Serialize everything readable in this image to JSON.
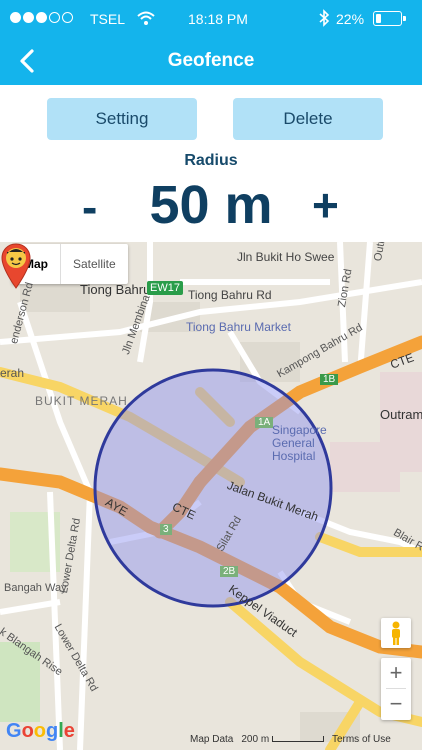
{
  "status_bar": {
    "carrier": "TSEL",
    "time": "18:18 PM",
    "battery_percent": "22%",
    "battery_level": 0.22
  },
  "nav": {
    "title": "Geofence"
  },
  "actions": {
    "setting_label": "Setting",
    "delete_label": "Delete"
  },
  "radius": {
    "label": "Radius",
    "minus_label": "-",
    "plus_label": "+",
    "value": "50 m"
  },
  "map": {
    "type_buttons": [
      "Map",
      "Satellite"
    ],
    "zoom_in_label": "+",
    "zoom_out_label": "−",
    "attribution": "Map Data",
    "scale_label": "200 m",
    "terms_label": "Terms of Use",
    "logo": "Google",
    "labels": {
      "jln_bukit_ho_swee": "Jln Bukit Ho Swee",
      "tiong_bahru": "Tiong Bahru",
      "ew17": "EW17",
      "tiong_bahru_rd": "Tiong Bahru Rd",
      "tiong_bahru_market": "Tiong Bahru Market",
      "jln_membina": "Jln Membina",
      "bukit_merah": "BUKIT MERAH",
      "cte_top": "CTE",
      "cte_mid": "CTE",
      "aye": "AYE",
      "jalan_bukit_merah": "Jalan Bukit Merah",
      "singapore_general_hospital": "Singapore General Hospital",
      "outram": "Outram",
      "outram_rd": "Outram Rd",
      "zion_rd": "Zion Rd",
      "lower_delta_rd": "Lower Delta Rd",
      "lower_delta_rd2": "Lower Delta Rd",
      "kampong_bahru_rd": "Kampong Bahru Rd",
      "keppel_viaduct": "Keppel Viaduct",
      "blair_rd": "Blair R",
      "silat_rd": "Silat Rd",
      "henderson_rd": "enderson Rd",
      "telok_blangah_rise": "k Blangah Rise",
      "bangah_way": "Bangah Way",
      "exit_1a": "1A",
      "exit_1b": "1B",
      "exit_2b": "2B",
      "exit_3": "3",
      "merah_left": "erah"
    },
    "colors": {
      "circle_fill": "#8a8df0",
      "circle_stroke": "#2f3a9c",
      "expressway": "#f4a23a",
      "major_road": "#f8d565"
    }
  }
}
